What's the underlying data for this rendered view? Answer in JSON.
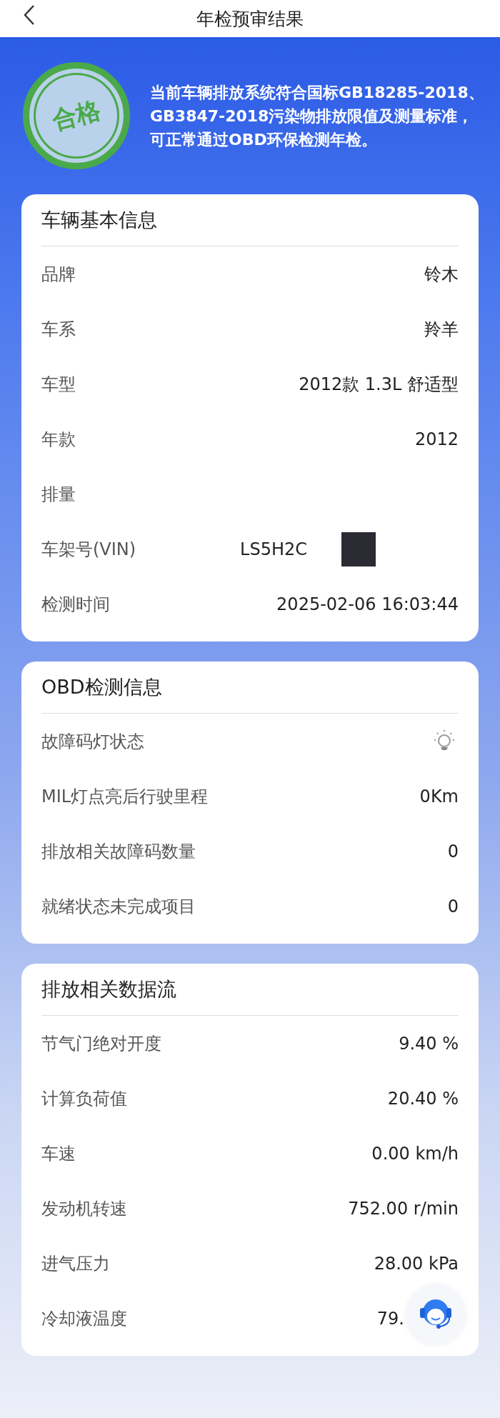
{
  "header": {
    "title": "年检预审结果"
  },
  "result": {
    "stamp": "合格",
    "passed": true,
    "message": "当前车辆排放系统符合国标GB18285-2018、GB3847-2018污染物排放限值及测量标准，可正常通过OBD环保检测年检。"
  },
  "sections": [
    {
      "title": "车辆基本信息",
      "rows": [
        {
          "label": "品牌",
          "kind": "text",
          "value": "铃木"
        },
        {
          "label": "车系",
          "kind": "text",
          "value": "羚羊"
        },
        {
          "label": "车型",
          "kind": "text",
          "value": "2012款 1.3L 舒适型"
        },
        {
          "label": "年款",
          "kind": "text",
          "value": "2012"
        },
        {
          "label": "排量",
          "kind": "empty"
        },
        {
          "label": "车架号(VIN)",
          "kind": "redacted",
          "value": "LS5H2C"
        },
        {
          "label": "检测时间",
          "kind": "text",
          "value": "2025-02-06 16:03:44"
        }
      ]
    },
    {
      "title": "OBD检测信息",
      "rows": [
        {
          "label": "故障码灯状态",
          "kind": "lamp",
          "on": false
        },
        {
          "label": "MIL灯点亮后行驶里程",
          "kind": "text",
          "value": "0Km"
        },
        {
          "label": "排放相关故障码数量",
          "kind": "text",
          "value": "0"
        },
        {
          "label": "就绪状态未完成项目",
          "kind": "text",
          "value": "0"
        }
      ]
    },
    {
      "title": "排放相关数据流",
      "rows": [
        {
          "label": "节气门绝对开度",
          "kind": "text",
          "value": "9.40 %"
        },
        {
          "label": "计算负荷值",
          "kind": "text",
          "value": "20.40 %"
        },
        {
          "label": "车速",
          "kind": "text",
          "value": "0.00 km/h"
        },
        {
          "label": "发动机转速",
          "kind": "text",
          "value": "752.00 r/min"
        },
        {
          "label": "进气压力",
          "kind": "text",
          "value": "28.00 kPa"
        },
        {
          "label": "冷却液温度",
          "kind": "covered",
          "value": "79."
        }
      ]
    }
  ]
}
